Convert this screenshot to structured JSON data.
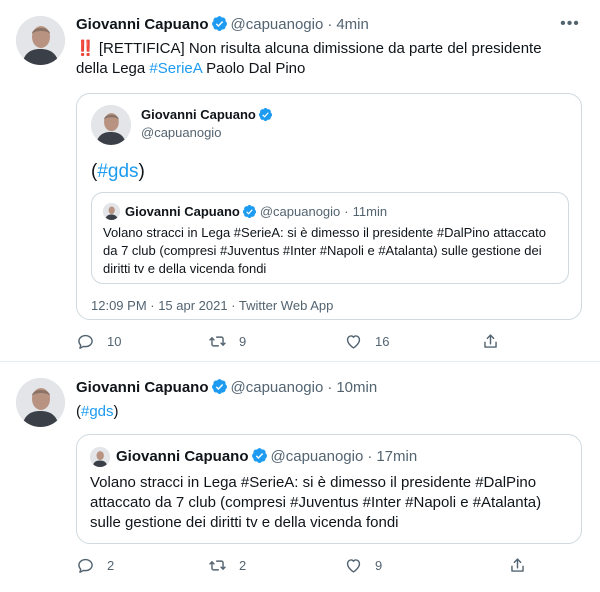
{
  "tweet1": {
    "author_name": "Giovanni Capuano",
    "author_handle": "@capuanogio",
    "separator": "·",
    "time": "4min",
    "text_prefix": "‼️ [RETTIFICA] Non risulta alcuna dimissione da parte del presidente della Lega ",
    "hashtag": "#SerieA",
    "text_suffix": " Paolo Dal Pino",
    "quoted": {
      "author_name": "Giovanni Capuano",
      "author_handle": "@capuanogio",
      "text_open": "(",
      "hashtag": "#gds",
      "text_close": ")",
      "nested": {
        "author_name": "Giovanni Capuano",
        "author_handle": "@capuanogio",
        "separator": "·",
        "time": "11min",
        "text": "Volano stracci in Lega #SerieA: si è dimesso il presidente #DalPino attaccato da 7 club (compresi #Juventus #Inter #Napoli e #Atalanta) sulle gestione dei diritti tv e della vicenda fondi"
      },
      "timestamp": "12:09 PM · 15 apr 2021 · Twitter Web App"
    },
    "replies": "10",
    "retweets": "9",
    "likes": "16"
  },
  "tweet2": {
    "author_name": "Giovanni Capuano",
    "author_handle": "@capuanogio",
    "separator": "·",
    "time": "10min",
    "text_open": "(",
    "hashtag": "#gds",
    "text_close": ")",
    "quoted": {
      "author_name": "Giovanni Capuano",
      "author_handle": "@capuanogio",
      "separator": "·",
      "time": "17min",
      "text": "Volano stracci in Lega #SerieA: si è dimesso il presidente #DalPino attaccato da 7 club (compresi #Juventus #Inter #Napoli e #Atalanta) sulle gestione dei diritti tv e della vicenda fondi"
    },
    "replies": "2",
    "retweets": "2",
    "likes": "9"
  },
  "icons": {
    "verified": "verified-badge-icon",
    "more": "more-icon",
    "reply": "reply-icon",
    "retweet": "retweet-icon",
    "like": "like-icon",
    "share": "share-icon"
  },
  "colors": {
    "accent": "#1d9bf0",
    "text": "#0f1419",
    "muted": "#536471",
    "border": "#cfd9de"
  }
}
